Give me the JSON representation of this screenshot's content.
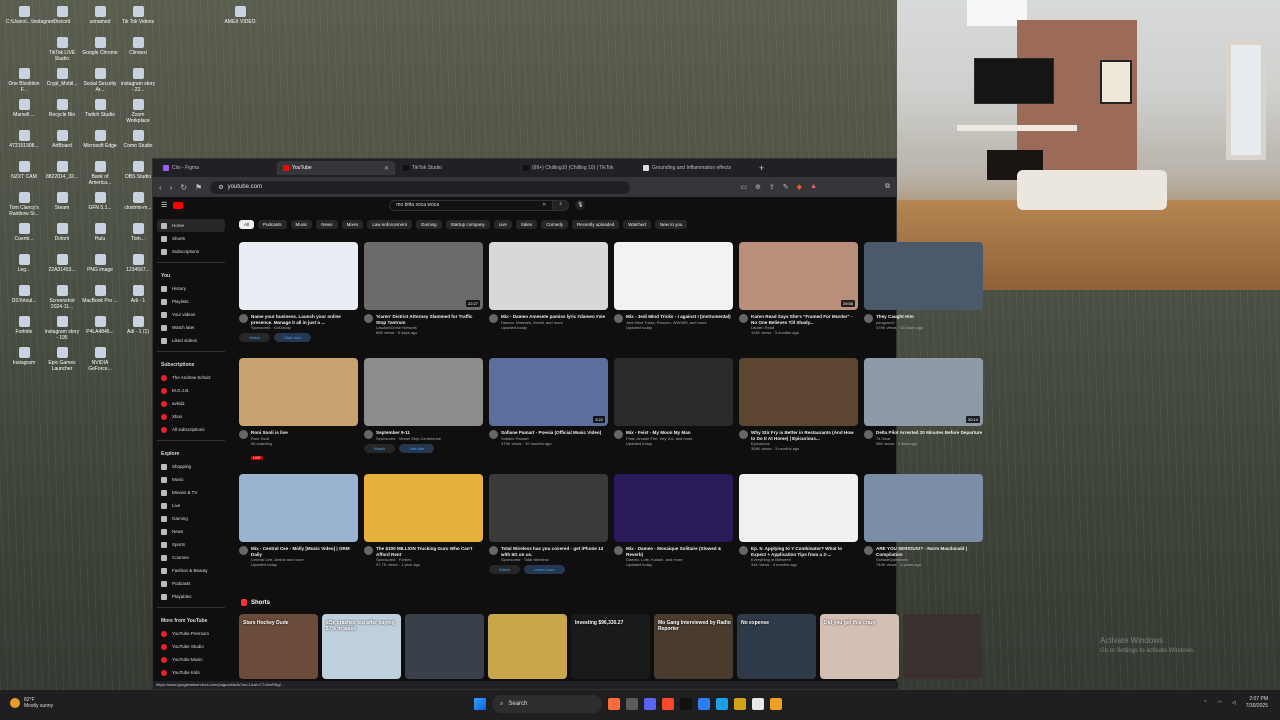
{
  "desktop_icons": [
    {
      "label": "C:\\Users\\...\\Instagram"
    },
    {
      "label": "Discord"
    },
    {
      "label": "unnamed"
    },
    {
      "label": "Tik Tok Videos"
    },
    {
      "label": "AMEX VIDEO"
    },
    {
      "label": "TikTok LIVE Studio"
    },
    {
      "label": "Google Chrome"
    },
    {
      "label": "Clinnexi"
    },
    {
      "label": "One Blocktion F..."
    },
    {
      "label": "Crypt_Mobil..."
    },
    {
      "label": "Social Security Ar..."
    },
    {
      "label": "instagram story - 22..."
    },
    {
      "label": "Marxell ..."
    },
    {
      "label": "Recycle Bin"
    },
    {
      "label": "Twitch Studio"
    },
    {
      "label": "Zoom Workplace"
    },
    {
      "label": "472151908..."
    },
    {
      "label": "ArtBoard"
    },
    {
      "label": "Microsoft Edge"
    },
    {
      "label": "Como Studio"
    },
    {
      "label": "NZXT CAM"
    },
    {
      "label": "8822014_32..."
    },
    {
      "label": "Bank of America..."
    },
    {
      "label": "OBS Studio"
    },
    {
      "label": "Tom Clancy's Rainbow Si..."
    },
    {
      "label": "Steam"
    },
    {
      "label": "GFN 5.1..."
    },
    {
      "label": "clostrini-m..."
    },
    {
      "label": "Cuentr..."
    },
    {
      "label": "Dotnm"
    },
    {
      "label": "Hulu"
    },
    {
      "label": "Tom..."
    },
    {
      "label": "Leg..."
    },
    {
      "label": "22A31453..."
    },
    {
      "label": "PNG image"
    },
    {
      "label": "1234567..."
    },
    {
      "label": "DSYotoul..."
    },
    {
      "label": "Screenshot 2024-11..."
    },
    {
      "label": "MacBook Pro ..."
    },
    {
      "label": "Adi - 1"
    },
    {
      "label": "Fortnite"
    },
    {
      "label": "instagram story - 195"
    },
    {
      "label": "P4LA4846..."
    },
    {
      "label": "Adi - 1 (1)"
    },
    {
      "label": "Instagram"
    },
    {
      "label": "Epic Games Launcher"
    },
    {
      "label": "NVIDIA GeForce..."
    }
  ],
  "browser": {
    "tabs": [
      {
        "label": "Clio - Figma",
        "color": "#a259ff",
        "active": false
      },
      {
        "label": "YouTube",
        "color": "#ff0000",
        "active": true
      },
      {
        "label": "TikTok Studio",
        "color": "#111111",
        "active": false
      },
      {
        "label": "(99+) Chilling10 (Chilling 10) | TikTok",
        "color": "#111111",
        "active": false
      },
      {
        "label": "Grounding and Inflammation effects",
        "color": "#dddddd",
        "active": false
      }
    ],
    "new_tab": "+",
    "url": "youtube.com"
  },
  "youtube": {
    "search_value": "mo bitta soca woca",
    "sidebar": {
      "main": [
        {
          "label": "Home",
          "active": true
        },
        {
          "label": "Shorts"
        },
        {
          "label": "Subscriptions"
        }
      ],
      "you_head": "You",
      "you": [
        {
          "label": "History"
        },
        {
          "label": "Playlists"
        },
        {
          "label": "Your videos"
        },
        {
          "label": "Watch later"
        },
        {
          "label": "Liked videos"
        }
      ],
      "subs_head": "Subscriptions",
      "subs": [
        {
          "label": "The Andrew Schulz"
        },
        {
          "label": "M.O.J.B."
        },
        {
          "label": "avkidz"
        },
        {
          "label": "Xbox"
        },
        {
          "label": "All subscriptions"
        }
      ],
      "explore_head": "Explore",
      "explore": [
        {
          "label": "Shopping"
        },
        {
          "label": "Music"
        },
        {
          "label": "Movies & TV"
        },
        {
          "label": "Live"
        },
        {
          "label": "Gaming"
        },
        {
          "label": "News"
        },
        {
          "label": "Sports"
        },
        {
          "label": "Courses"
        },
        {
          "label": "Fashion & Beauty"
        },
        {
          "label": "Podcasts"
        },
        {
          "label": "Playables"
        }
      ],
      "more_head": "More from YouTube",
      "more": [
        {
          "label": "YouTube Premium"
        },
        {
          "label": "YouTube Studio"
        },
        {
          "label": "YouTube Music"
        },
        {
          "label": "YouTube Kids"
        }
      ]
    },
    "chips": [
      "All",
      "Podcasts",
      "Music",
      "News",
      "Mixes",
      "Law enforcement",
      "Gaming",
      "Startup company",
      "Live",
      "Sales",
      "Comedy",
      "Recently uploaded",
      "Watched",
      "New to you"
    ],
    "videos": [
      {
        "title": "Name your business. Launch your online presence. Manage it all in just a ...",
        "sub": "Sponsored · GoDaddy",
        "sub2": "",
        "thumb": "#e9eef5",
        "btn1": "Watch",
        "btn2": "Start now"
      },
      {
        "title": "'Karen' District Attorney Slammed for Traffic Stop Tantrum",
        "sub": "LawAndCrime Network",
        "sub2": "86K views · 5 days ago",
        "thumb": "#6d6a6c",
        "dur": "22:27"
      },
      {
        "title": "Mix - Dameo Amesete pamiss lyric #dameo #vie",
        "sub": "Dameo, Malesek, Mvelti, and more",
        "sub2": "Updated today",
        "thumb": "#d8d8d8"
      },
      {
        "title": "Mix - Jedi Mind Tricks - I against I (Instrumental)",
        "sub": "Jedi Mind Tricks, Ronson, WWWM, and more",
        "sub2": "Updated today",
        "thumb": "#f2f2f2"
      },
      {
        "title": "Karen Read Says She's \"Framed For Murder\" - No One Believes Till Shady...",
        "sub": "Lauren Read",
        "sub2": "114K views · 3 months ago",
        "thumb": "#b98f7c",
        "dur": "29:56"
      },
      {
        "title": "They Caught Him",
        "sub": "penguinz0",
        "sub2": "475K views · 15 hours ago",
        "thumb": "#4a5a6a"
      },
      {
        "title": "Roni Sooli is live",
        "sub": "Roni Sooli",
        "sub2": "56 watching",
        "thumb": "#c9a36f",
        "live": "LIVE"
      },
      {
        "title": "September 9-11",
        "sub": "Sponsored · Vercel Ship Conference",
        "sub2": "",
        "thumb": "#8c8d8a",
        "btn1": "Watch",
        "btn2": "Visit site"
      },
      {
        "title": "Sofiane Pamart - Poesia (Official Music Video)",
        "sub": "Sofiane Pamart",
        "sub2": "476K views · 10 months ago",
        "thumb": "#5b6e9c",
        "dur": "3:22"
      },
      {
        "title": "Mix - Feist - My Moon My Man",
        "sub": "Feist, Arcade Fire, Hey Zoi, and more",
        "sub2": "Updated today",
        "thumb": "#2a2a2a"
      },
      {
        "title": "Why Stir Fry is Better in Restaurants (And How to Do It At Home) | Epicurious...",
        "sub": "Epicurious",
        "sub2": "308K views · 3 months ago",
        "thumb": "#5c4632"
      },
      {
        "title": "Delta Pilot Arrested 20 Minutes Before Departure",
        "sub": "74 Gear",
        "sub2": "96K views · 3 days ago",
        "thumb": "#8e9aa5",
        "dur": "20:14"
      },
      {
        "title": "Mix - Central Cee - Molly [Music Video] | GRM Daily",
        "sub": "Central Cee, Aminé and more",
        "sub2": "Updated today",
        "thumb": "#9ab3d0"
      },
      {
        "title": "The $100 MILLION Trucking Guru Who Can't Afford Rent",
        "sub": "Sponsored · Forbes",
        "sub2": "97.7K views · 1 year ago",
        "thumb": "#e7b13c"
      },
      {
        "title": "Total Wireless has you covered - get iPhone 13 with 5G on us.",
        "sub": "Sponsored · Total Wireless",
        "sub2": "",
        "thumb": "#3a3a3a",
        "btn1": "Watch",
        "btn2": "Learn more"
      },
      {
        "title": "Mix - Dameo - Mosaique Solitaire (Slowed & Reverb)",
        "sub": "Dameo, Lofe, Kolash, and more",
        "sub2": "Updated today",
        "thumb": "#2b1a5a"
      },
      {
        "title": "Ep. 5: Applying to Y Combinator? What to Expect + Application Tips from a 2-...",
        "sub": "Everything in Between",
        "sub2": "34K views · 4 months ago",
        "thumb": "#f0f0f0"
      },
      {
        "title": "ARE YOU SERIOUS!? - Norm Macdonald | Compilation",
        "sub": "OutsideQuestions",
        "sub2": "744K views · 4 years ago",
        "thumb": "#7a8ea8"
      }
    ],
    "shorts_head": "Shorts",
    "shorts": [
      {
        "label": "Stars Hockey Dude",
        "color": "#6b4b3a"
      },
      {
        "label": "xQc crashes out after paying $7% in taxes",
        "color": "#bfd0dd"
      },
      {
        "label": "",
        "color": "#3a4049"
      },
      {
        "label": "",
        "color": "#c9a64b"
      },
      {
        "label": "Investing $96,330.27",
        "color": "#1a1a1a"
      },
      {
        "label": "Mo Gang Interviewed by Radio Reporter",
        "color": "#4a3b2f"
      },
      {
        "label": "No expense",
        "color": "#2e3a48"
      },
      {
        "label": "Did you get this crazy",
        "color": "#d4bfb4"
      },
      {
        "label": "",
        "color": "#3a3030"
      }
    ],
    "status_url": "https://www.googleadservices.com/pagead/aclk?sa=L&ai=CTv8nrR6gl..."
  },
  "watermark": {
    "title": "Activate Windows",
    "sub": "Go to Settings to activate Windows."
  },
  "taskbar": {
    "weather_temp": "82°F",
    "weather_desc": "Mostly sunny",
    "search_label": "Search",
    "time": "2:07 PM",
    "date": "7/30/2025",
    "apps": [
      "#ff6a3d",
      "#5a5a5a",
      "#5865f2",
      "#ff4a2a",
      "#111111",
      "#2d7df6",
      "#1ca0ea",
      "#d2a31a",
      "#e8e8e8",
      "#f0a020"
    ]
  }
}
